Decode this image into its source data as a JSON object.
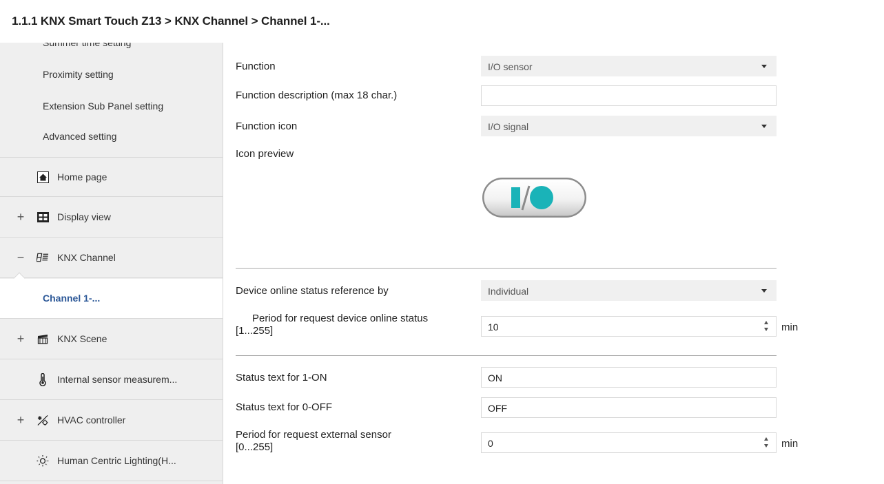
{
  "breadcrumb": "1.1.1 KNX Smart Touch Z13 > KNX Channel  > Channel 1-...",
  "sidebar": {
    "sub_items": [
      "Summer time setting",
      "Proximity setting",
      "Extension Sub Panel setting",
      "Advanced setting"
    ],
    "nav": {
      "home": {
        "label": "Home page",
        "icon": "home-icon"
      },
      "display": {
        "expander": "+",
        "label": "Display view",
        "icon": "display-view-icon"
      },
      "knx_channel": {
        "expander": "−",
        "label": "KNX Channel",
        "icon": "knx-channel-icon"
      },
      "channel1": {
        "label": "Channel 1-..."
      },
      "knx_scene": {
        "expander": "+",
        "label": "KNX Scene",
        "icon": "scene-icon"
      },
      "sensor": {
        "label": "Internal sensor measurem...",
        "icon": "thermometer-icon"
      },
      "hvac": {
        "expander": "+",
        "label": "HVAC controller",
        "icon": "hvac-icon"
      },
      "hcl": {
        "label": "Human Centric Lighting(H...",
        "icon": "sun-icon"
      }
    }
  },
  "form": {
    "function": {
      "label": "Function",
      "value": "I/O sensor"
    },
    "description": {
      "label": "Function description (max 18 char.)",
      "value": ""
    },
    "icon": {
      "label": "Function icon",
      "value": "I/O signal"
    },
    "preview": {
      "label": "Icon preview",
      "icon": "io-signal-icon"
    },
    "online_ref": {
      "label": "Device online status reference by",
      "value": "Individual"
    },
    "online_period": {
      "label_line1": "Period for request device online status",
      "label_line2": "[1...255]",
      "value": "10",
      "unit": "min"
    },
    "on_text": {
      "label": "Status text for 1-ON",
      "value": "ON"
    },
    "off_text": {
      "label": "Status text for 0-OFF",
      "value": "OFF"
    },
    "ext_period": {
      "label_line1": "Period for request external sensor",
      "label_line2": "[0...255]",
      "value": "0",
      "unit": "min"
    }
  },
  "colors": {
    "accent": "#2b5797",
    "io_icon": "#1ab3b8",
    "sidebar_bg": "#efefef"
  }
}
